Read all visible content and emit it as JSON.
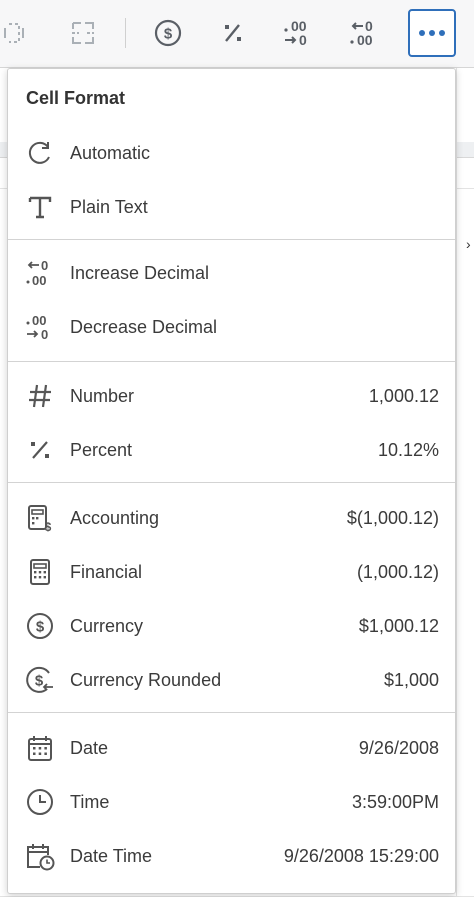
{
  "toolbar": {
    "buttons": [
      {
        "icon": "merge-cells-icon"
      },
      {
        "icon": "unmerge-cells-icon"
      },
      {
        "icon": "currency-icon"
      },
      {
        "icon": "percent-icon"
      },
      {
        "icon": "decrease-decimal-icon"
      },
      {
        "icon": "increase-decimal-icon"
      },
      {
        "icon": "more-options-icon"
      }
    ],
    "accent": "#2f6fba"
  },
  "menu": {
    "title": "Cell Format",
    "sections": [
      {
        "items": [
          {
            "label": "Automatic",
            "value": "",
            "icon": "automatic-icon"
          },
          {
            "label": "Plain Text",
            "value": "",
            "icon": "plain-text-icon"
          }
        ]
      },
      {
        "items": [
          {
            "label": "Increase Decimal",
            "value": "",
            "icon": "increase-decimal-icon"
          },
          {
            "label": "Decrease Decimal",
            "value": "",
            "icon": "decrease-decimal-icon"
          }
        ]
      },
      {
        "items": [
          {
            "label": "Number",
            "value": "1,000.12",
            "icon": "number-icon"
          },
          {
            "label": "Percent",
            "value": "10.12%",
            "icon": "percent-icon"
          }
        ]
      },
      {
        "items": [
          {
            "label": "Accounting",
            "value": "$(1,000.12)",
            "icon": "accounting-icon"
          },
          {
            "label": "Financial",
            "value": "(1,000.12)",
            "icon": "financial-icon"
          },
          {
            "label": "Currency",
            "value": "$1,000.12",
            "icon": "currency-icon"
          },
          {
            "label": "Currency Rounded",
            "value": "$1,000",
            "icon": "currency-rounded-icon"
          }
        ]
      },
      {
        "items": [
          {
            "label": "Date",
            "value": "9/26/2008",
            "icon": "date-icon"
          },
          {
            "label": "Time",
            "value": "3:59:00PM",
            "icon": "time-icon"
          },
          {
            "label": "Date Time",
            "value": "9/26/2008 15:29:00",
            "icon": "date-time-icon"
          }
        ]
      }
    ]
  }
}
